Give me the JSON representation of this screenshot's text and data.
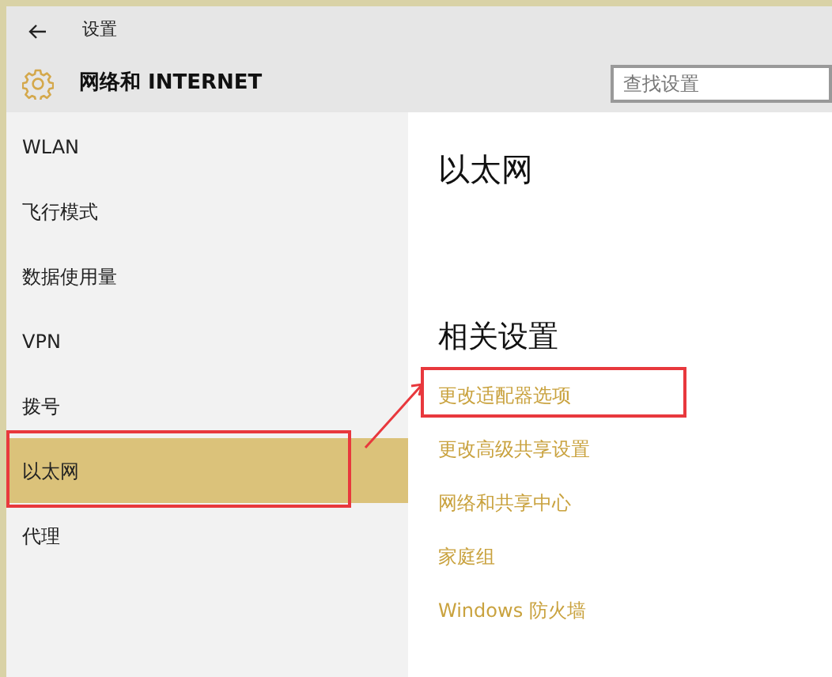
{
  "window": {
    "title": "设置"
  },
  "header": {
    "title": "网络和 INTERNET",
    "search": {
      "placeholder": "查找设置"
    }
  },
  "sidebar": {
    "items": [
      {
        "label": "WLAN",
        "selected": false,
        "annotated": false
      },
      {
        "label": "飞行模式",
        "selected": false,
        "annotated": false
      },
      {
        "label": "数据使用量",
        "selected": false,
        "annotated": false
      },
      {
        "label": "VPN",
        "selected": false,
        "annotated": false
      },
      {
        "label": "拨号",
        "selected": false,
        "annotated": false
      },
      {
        "label": "以太网",
        "selected": true,
        "annotated": true
      },
      {
        "label": "代理",
        "selected": false,
        "annotated": false
      }
    ]
  },
  "content": {
    "title": "以太网",
    "section_title": "相关设置",
    "links": [
      {
        "label": "更改适配器选项",
        "annotated": true
      },
      {
        "label": "更改高级共享设置",
        "annotated": false
      },
      {
        "label": "网络和共享中心",
        "annotated": false
      },
      {
        "label": "家庭组",
        "annotated": false
      },
      {
        "label": "Windows 防火墙",
        "annotated": false
      }
    ]
  },
  "annotation_arrow": true
}
